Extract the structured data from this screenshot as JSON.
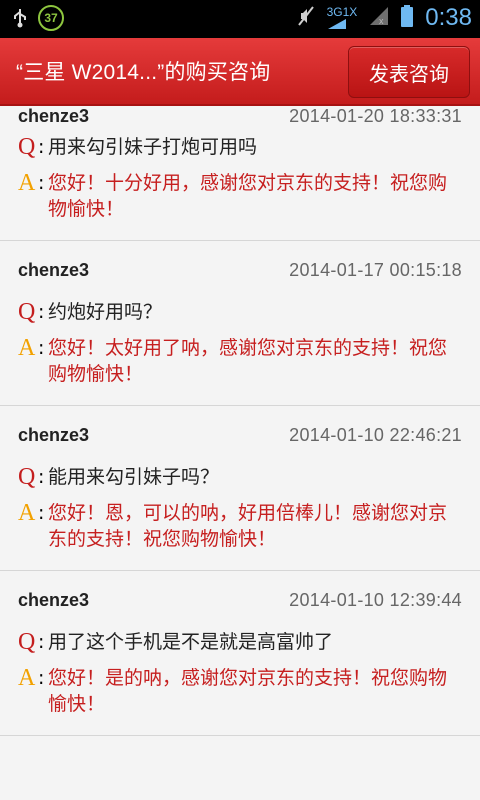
{
  "status_bar": {
    "badge": "37",
    "network": "3G1X",
    "time": "0:38"
  },
  "header": {
    "title": "“三星 W2014...”的购买咨询",
    "button": "发表咨询"
  },
  "items": [
    {
      "user": "chenze3",
      "date": "2014-01-20 18:33:31",
      "q": "用来勾引妹子打炮可用吗",
      "a": "您好！十分好用，感谢您对京东的支持！祝您购物愉快！"
    },
    {
      "user": "chenze3",
      "date": "2014-01-17 00:15:18",
      "q": "约炮好用吗？",
      "a": "您好！太好用了呐，感谢您对京东的支持！祝您购物愉快！"
    },
    {
      "user": "chenze3",
      "date": "2014-01-10 22:46:21",
      "q": "能用来勾引妹子吗？",
      "a": "您好！恩，可以的呐，好用倍棒儿！感谢您对京东的支持！祝您购物愉快！"
    },
    {
      "user": "chenze3",
      "date": "2014-01-10 12:39:44",
      "q": "用了这个手机是不是就是高富帅了",
      "a": "您好！是的呐，感谢您对京东的支持！祝您购物愉快！"
    }
  ],
  "labels": {
    "q": "Q",
    "a": "A",
    "colon": ":"
  }
}
